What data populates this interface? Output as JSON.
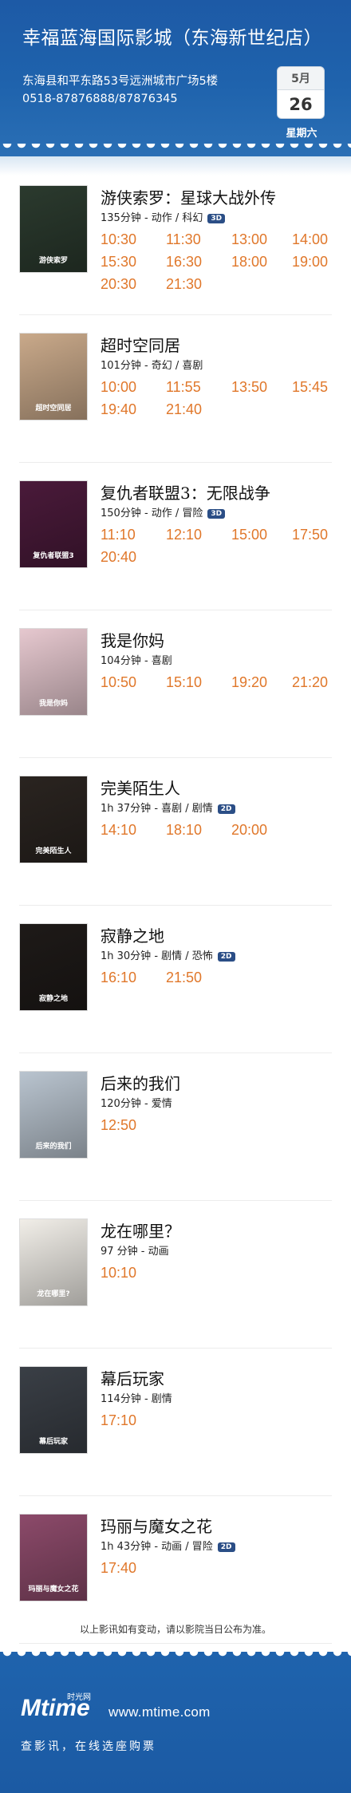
{
  "header": {
    "cinema_name": "幸福蓝海国际影城（东海新世纪店）",
    "address": "东海县和平东路53号远洲城市广场5楼",
    "phone": "0518-87876888/87876345",
    "month": "5月",
    "day": "26",
    "weekday": "星期六"
  },
  "movies": [
    {
      "title": "游侠索罗：星球大战外传",
      "meta": "135分钟 - 动作 / 科幻",
      "badge": "3D",
      "poster_color": "#2b3a2e",
      "poster_text": "游侠索罗",
      "times": [
        "10:30",
        "11:30",
        "13:00",
        "14:00",
        "15:30",
        "16:30",
        "18:00",
        "19:00",
        "20:30",
        "21:30"
      ]
    },
    {
      "title": "超时空同居",
      "meta": "101分钟 - 奇幻 / 喜剧",
      "badge": "",
      "poster_color": "#c9a98a",
      "poster_text": "超时空同居",
      "times": [
        "10:00",
        "11:55",
        "13:50",
        "15:45",
        "19:40",
        "21:40"
      ]
    },
    {
      "title": "复仇者联盟3：无限战争",
      "meta": "150分钟 - 动作 / 冒险",
      "badge": "3D",
      "poster_color": "#4a1a3a",
      "poster_text": "复仇者联盟3",
      "times": [
        "11:10",
        "12:10",
        "15:00",
        "17:50",
        "20:40"
      ]
    },
    {
      "title": "我是你妈",
      "meta": "104分钟 - 喜剧",
      "badge": "",
      "poster_color": "#e6c8cf",
      "poster_text": "我是你妈",
      "times": [
        "10:50",
        "15:10",
        "19:20",
        "21:20"
      ]
    },
    {
      "title": "完美陌生人",
      "meta": "1h 37分钟 - 喜剧 / 剧情",
      "badge": "2D",
      "poster_color": "#2a2420",
      "poster_text": "完美陌生人",
      "times": [
        "14:10",
        "18:10",
        "20:00"
      ]
    },
    {
      "title": "寂静之地",
      "meta": "1h 30分钟 - 剧情 / 恐怖",
      "badge": "2D",
      "poster_color": "#1e1a18",
      "poster_text": "寂静之地",
      "times": [
        "16:10",
        "21:50"
      ]
    },
    {
      "title": "后来的我们",
      "meta": "120分钟 - 爱情",
      "badge": "",
      "poster_color": "#b9c4cf",
      "poster_text": "后来的我们",
      "times": [
        "12:50"
      ]
    },
    {
      "title": "龙在哪里？",
      "meta": "97 分钟 - 动画",
      "badge": "",
      "poster_color": "#f1eee8",
      "poster_text": "龙在哪里?",
      "times": [
        "10:10"
      ]
    },
    {
      "title": "幕后玩家",
      "meta": "114分钟 - 剧情",
      "badge": "",
      "poster_color": "#3a3f46",
      "poster_text": "幕后玩家",
      "times": [
        "17:10"
      ]
    },
    {
      "title": "玛丽与魔女之花",
      "meta": "1h 43分钟 - 动画 / 冒险",
      "badge": "2D",
      "poster_color": "#8c4a6a",
      "poster_text": "玛丽与魔女之花",
      "times": [
        "17:40"
      ]
    }
  ],
  "notice": "以上影讯如有变动，请以影院当日公布为准。",
  "footer": {
    "logo_text": "Mtime",
    "logo_sub": "时光网",
    "site": "www.mtime.com",
    "slogan": "查影讯，在线选座购票"
  }
}
